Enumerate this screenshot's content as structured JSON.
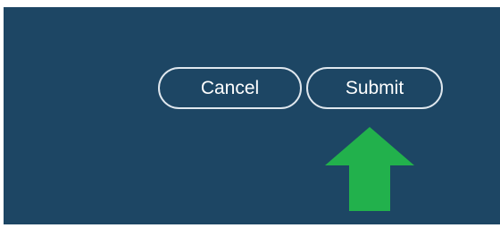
{
  "dialog_actions": {
    "cancel_label": "Cancel",
    "submit_label": "Submit"
  },
  "annotation": {
    "icon": "arrow-up-icon",
    "color": "#22b14c"
  },
  "colors": {
    "panel_background": "#1d4664",
    "button_border": "#dfe7ee",
    "button_text": "#ffffff"
  }
}
